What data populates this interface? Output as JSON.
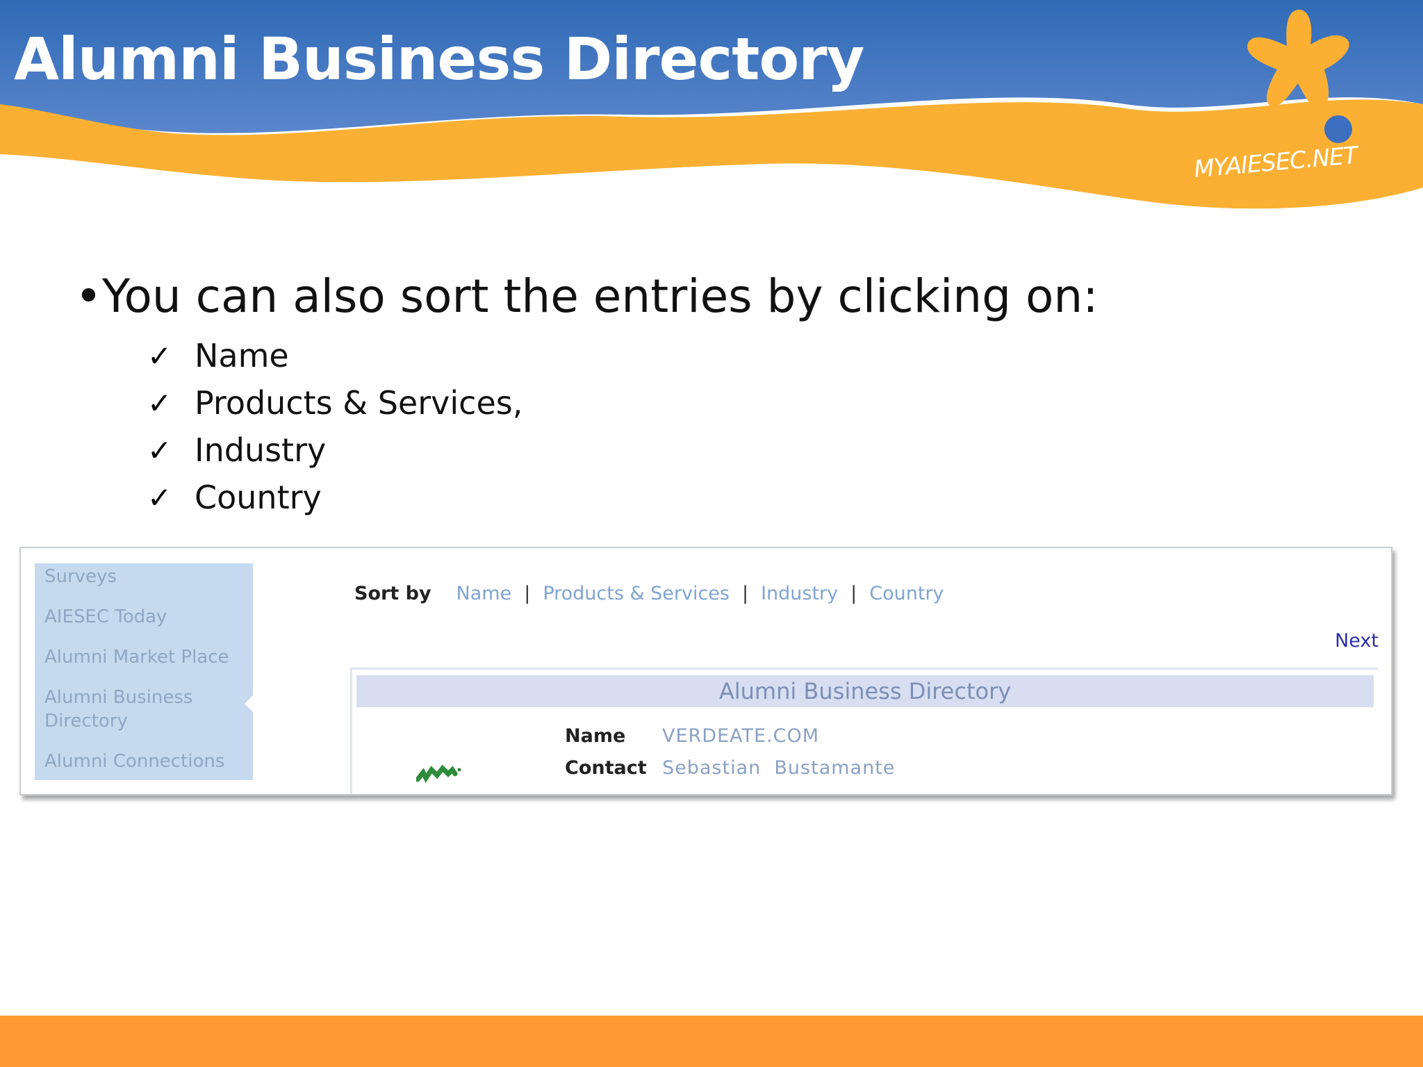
{
  "slide": {
    "title": "Alumni Business Directory",
    "brand": "MYAIESEC.NET",
    "bullet": "•You can also sort the entries by clicking on:",
    "checklist": [
      "Name",
      "Products & Services,",
      "Industry",
      "Country"
    ]
  },
  "screenshot": {
    "sidebar": {
      "items": [
        "Surveys",
        "AIESEC Today",
        "Alumni Market Place",
        "Alumni Business Directory",
        "Alumni Connections"
      ],
      "active_index": 3
    },
    "sort": {
      "label": "Sort by",
      "links": [
        "Name",
        "Products & Services",
        "Industry",
        "Country"
      ],
      "separator": "|"
    },
    "pager": {
      "next_label": "Next"
    },
    "directory": {
      "header": "Alumni Business Directory",
      "fields": [
        {
          "label": "Name",
          "value": "VERDEATE.COM"
        },
        {
          "label": "Contact",
          "value": "Sebastian  Bustamante"
        }
      ]
    }
  },
  "colors": {
    "header_blue": "#3a6fb8",
    "wave_orange": "#fbb034",
    "footer_orange": "#ff9a33",
    "sidebar_bg": "#c5daee",
    "link_blue": "#7fa4d4",
    "next_link": "#2b2fa8",
    "dir_header_bg": "#d8def2"
  },
  "icons": [
    "starfish-mascot-icon",
    "check-icon",
    "company-logo-icon"
  ]
}
